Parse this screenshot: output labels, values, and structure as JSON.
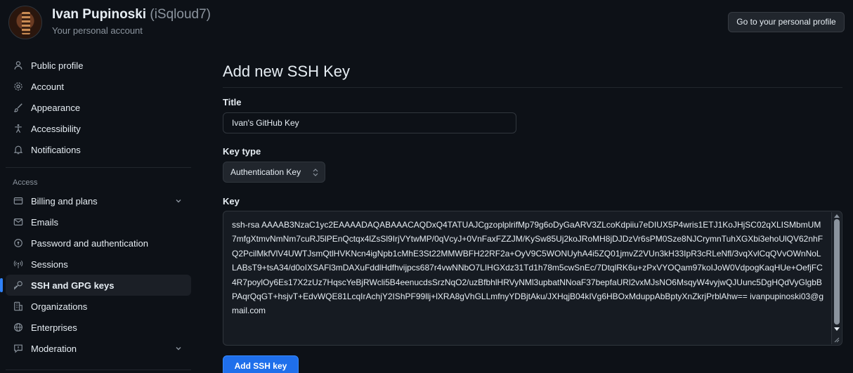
{
  "header": {
    "user_name": "Ivan Pupinoski",
    "user_handle": "(iSqloud7)",
    "subtitle": "Your personal account",
    "profile_button_label": "Go to your personal profile"
  },
  "sidebar": {
    "items": [
      {
        "label": "Public profile",
        "icon": "person-icon"
      },
      {
        "label": "Account",
        "icon": "gear-icon"
      },
      {
        "label": "Appearance",
        "icon": "paintbrush-icon"
      },
      {
        "label": "Accessibility",
        "icon": "accessibility-icon"
      },
      {
        "label": "Notifications",
        "icon": "bell-icon"
      }
    ],
    "access_heading": "Access",
    "access_items": [
      {
        "label": "Billing and plans",
        "icon": "credit-card-icon",
        "expandable": true
      },
      {
        "label": "Emails",
        "icon": "mail-icon"
      },
      {
        "label": "Password and authentication",
        "icon": "shield-lock-icon"
      },
      {
        "label": "Sessions",
        "icon": "broadcast-icon"
      },
      {
        "label": "SSH and GPG keys",
        "icon": "key-icon",
        "active": true
      },
      {
        "label": "Organizations",
        "icon": "organization-icon"
      },
      {
        "label": "Enterprises",
        "icon": "globe-icon"
      },
      {
        "label": "Moderation",
        "icon": "report-icon",
        "expandable": true
      }
    ]
  },
  "main": {
    "page_title": "Add new SSH Key",
    "title_label": "Title",
    "title_value": "Ivan's GitHub Key",
    "key_type_label": "Key type",
    "key_type_value": "Authentication Key",
    "key_label": "Key",
    "key_value": "ssh-rsa AAAAB3NzaC1yc2EAAAADAQABAAACAQDxQ4TATUAJCgzoplplrifMp79g6oDyGaARV3ZLcoKdpiiu7eDIUX5P4wris1ETJ1KoJHjSC02qXLISMbmUM7mfgXtmvNmNm7cuRJ5lPEnQctqx4lZsSl9IrjVYtwMP/0qVcyJ+0VnFaxFZZJM/KySw85Uj2koJRoMH8jDJDzVr6sPM0Sze8NJCrymnTuhXGXbi3ehoUlQV62nhFQ2PcilMkfVlV4UWTJsmQtlHVKNcn4igNpb1cMhE3St22MMWBFH22RF2a+OyV9C5WONUyhA4i5ZQ01jmvZ2VUn3kH33IpR3cRLeNfl/3vqXvlCqQVvOWnNoLLABsT9+tsA34/d0oIXSAFl3mDAXuFddlHdfhvijpcs687r4vwNNbO7LIHGXdz31Td1h78m5cwSnEc/7DtqlRK6u+zPxVYOQam97koIJoW0VdpogKaqHUe+OefjFC4R7poylOy6Es17X2zUz7HqscYeBjRWcli5B4eenucdsSrzNqO2/uzBfbhlHRVyNMl3upbatNNoaF37bepfaURl2vxMJsNO6MsqyW4vyjwQJUunc5DgHQdVyGlgbBPAqrQqGT+hsjvT+EdvWQE81LcqIrAchjY2IShPF99llj+lXRA8gVhGLLmfnyYDBjtAku/JXHqjB04kIVg6HBOxMduppAbBptyXnZkrjPrblAhw== ivanpupinoski03@gmail.com",
    "submit_label": "Add SSH key"
  },
  "colors": {
    "background": "#0d1117",
    "accent": "#1f6feb",
    "active_indicator": "#2f81f7",
    "muted_text": "#8b949e",
    "border": "#30363d"
  }
}
